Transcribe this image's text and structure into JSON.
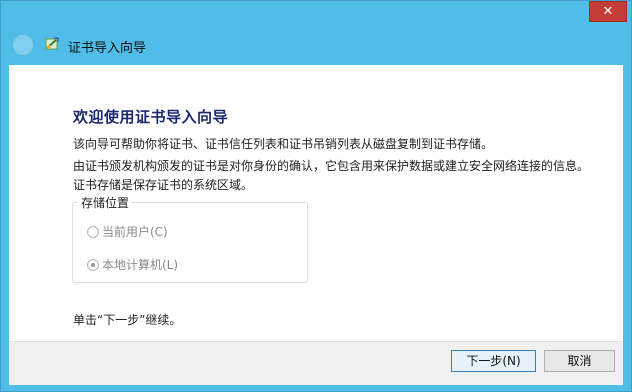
{
  "window": {
    "close_glyph": "✕",
    "title": "证书导入向导"
  },
  "content": {
    "heading": "欢迎使用证书导入向导",
    "intro": "该向导可帮助你将证书、证书信任列表和证书吊销列表从磁盘复制到证书存储。",
    "description": "由证书颁发机构颁发的证书是对你身份的确认，它包含用来保护数据或建立安全网络连接的信息。证书存储是保存证书的系统区域。",
    "store_location": {
      "legend": "存储位置",
      "options": [
        {
          "label": "当前用户(C)",
          "checked": false,
          "enabled": false
        },
        {
          "label": "本地计算机(L)",
          "checked": true,
          "enabled": false
        }
      ]
    },
    "continue_text": "单击“下一步”继续。"
  },
  "footer": {
    "next_label": "下一步(N)",
    "cancel_label": "取消"
  },
  "colors": {
    "frame": "#4fbde8",
    "heading": "#1c2a6e",
    "close": "#c43c35"
  }
}
